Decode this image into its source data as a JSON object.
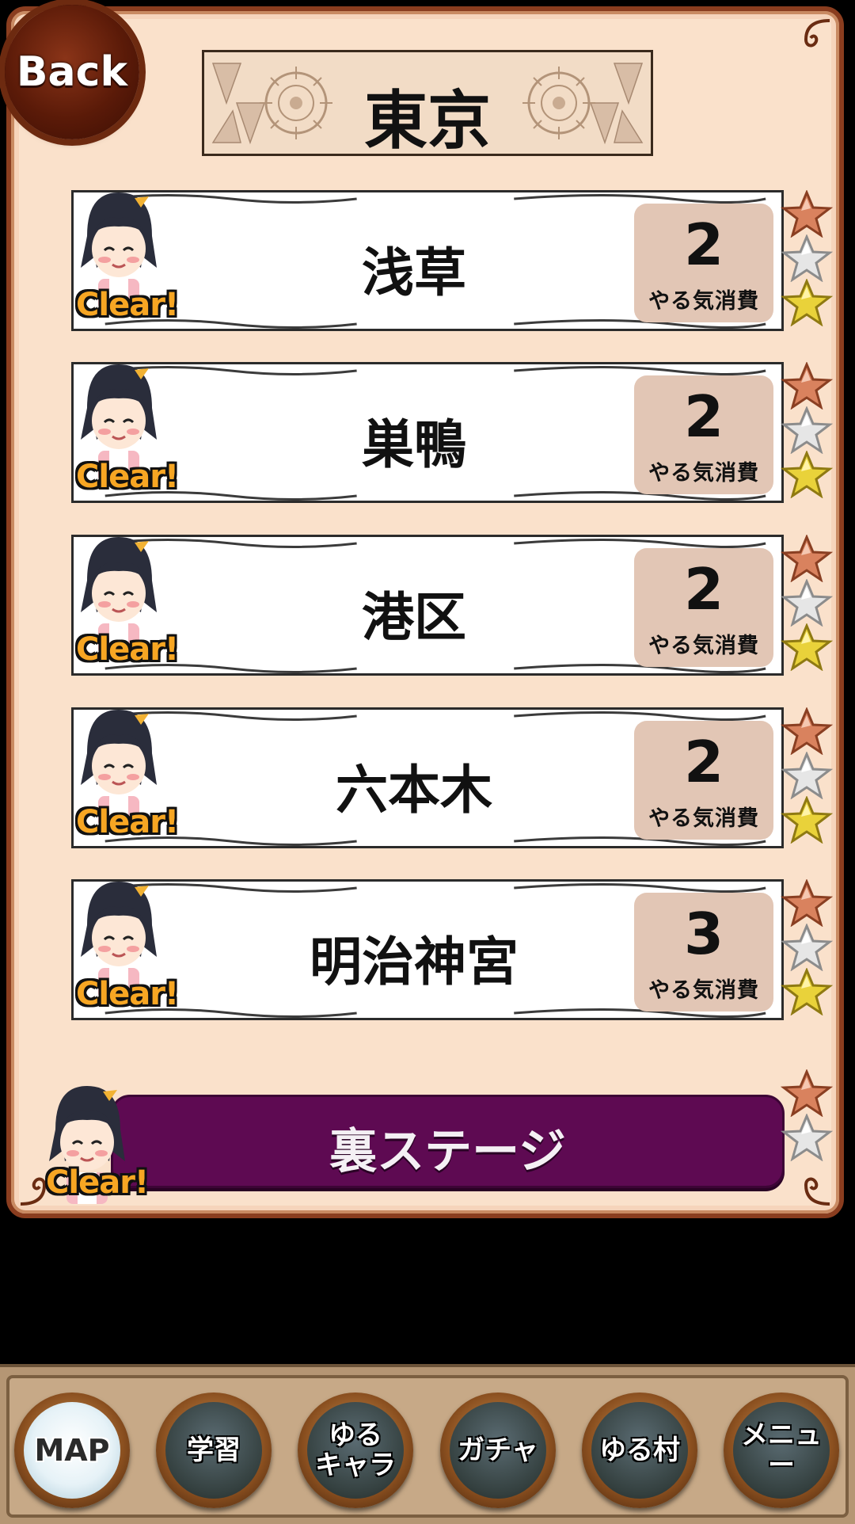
{
  "header": {
    "back_label": "Back",
    "title": "東京"
  },
  "stages": [
    {
      "name": "浅草",
      "cost": "2",
      "cost_label": "やる気消費",
      "status": "Clear!",
      "stars": [
        "bronze",
        "silver",
        "gold"
      ]
    },
    {
      "name": "巣鴨",
      "cost": "2",
      "cost_label": "やる気消費",
      "status": "Clear!",
      "stars": [
        "bronze",
        "silver",
        "gold"
      ]
    },
    {
      "name": "港区",
      "cost": "2",
      "cost_label": "やる気消費",
      "status": "Clear!",
      "stars": [
        "bronze",
        "silver",
        "gold"
      ]
    },
    {
      "name": "六本木",
      "cost": "2",
      "cost_label": "やる気消費",
      "status": "Clear!",
      "stars": [
        "bronze",
        "silver",
        "gold"
      ]
    },
    {
      "name": "明治神宮",
      "cost": "3",
      "cost_label": "やる気消費",
      "status": "Clear!",
      "stars": [
        "bronze",
        "silver",
        "gold"
      ]
    }
  ],
  "ura_stage": {
    "label": "裏ステージ",
    "status": "Clear!",
    "stars": [
      "bronze",
      "silver"
    ]
  },
  "nav": [
    {
      "label": "MAP",
      "active": true
    },
    {
      "label": "学習",
      "active": false
    },
    {
      "label": "ゆる\nキャラ",
      "active": false
    },
    {
      "label": "ガチャ",
      "active": false
    },
    {
      "label": "ゆる村",
      "active": false
    },
    {
      "label": "メニュー",
      "active": false
    }
  ],
  "colors": {
    "panel_bg": "#fae1cb",
    "frame": "#8a3d1f",
    "cost_box": "#e2c6b5",
    "ura_button": "#5e0a52",
    "clear_text": "#f7a623",
    "star_bronze": "#d9825e",
    "star_silver": "#e6e6e6",
    "star_gold": "#e9d23a"
  }
}
